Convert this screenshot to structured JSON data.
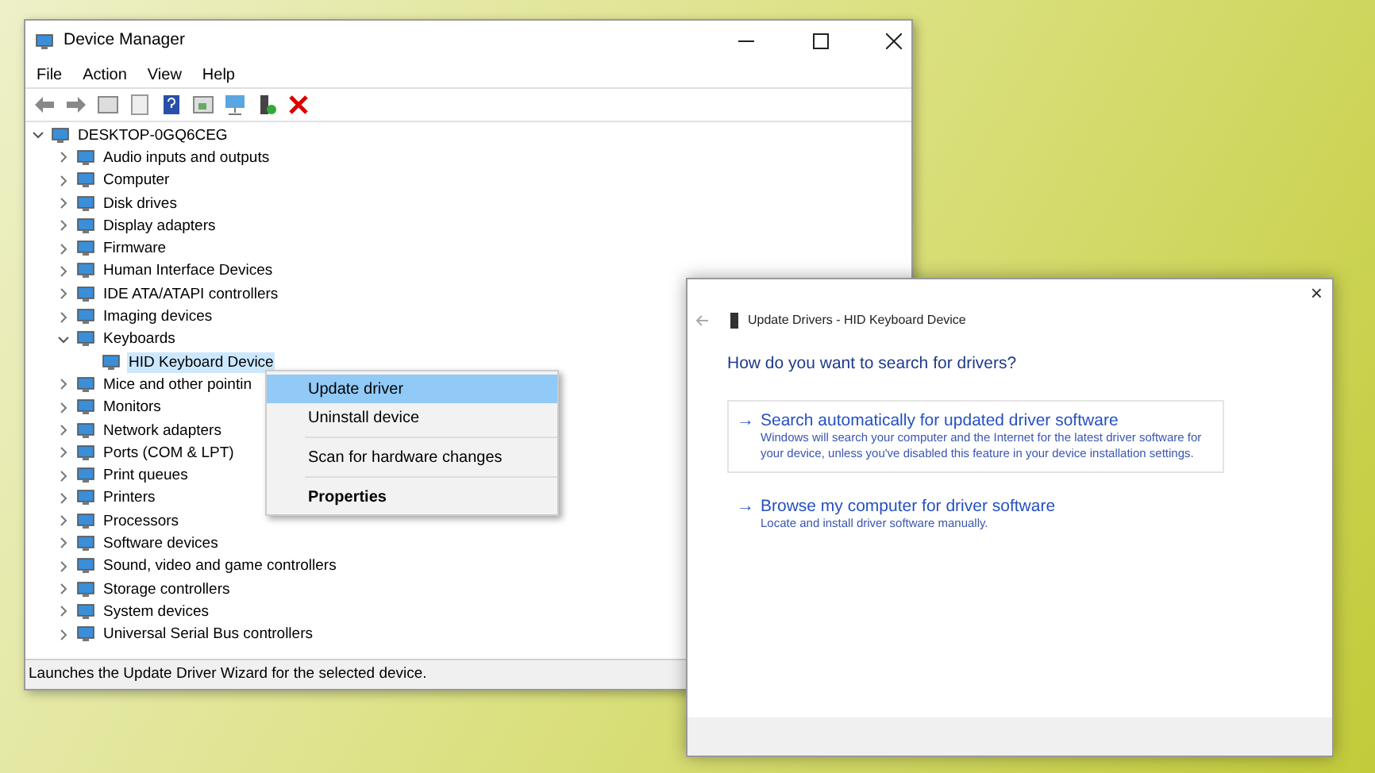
{
  "device_manager": {
    "title": "Device Manager",
    "menu": [
      "File",
      "Action",
      "View",
      "Help"
    ],
    "tree": {
      "label": "DESKTOP-0GQ6CEG",
      "expanded": true,
      "selected": false,
      "children": [
        {
          "label": "Audio inputs and outputs",
          "expanded": false,
          "selected": false
        },
        {
          "label": "Computer",
          "expanded": false,
          "selected": false
        },
        {
          "label": "Disk drives",
          "expanded": false,
          "selected": false
        },
        {
          "label": "Display adapters",
          "expanded": false,
          "selected": false
        },
        {
          "label": "Firmware",
          "expanded": false,
          "selected": false
        },
        {
          "label": "Human Interface Devices",
          "expanded": false,
          "selected": false
        },
        {
          "label": "IDE ATA/ATAPI controllers",
          "expanded": false,
          "selected": false
        },
        {
          "label": "Imaging devices",
          "expanded": false,
          "selected": false
        },
        {
          "label": "Keyboards",
          "expanded": true,
          "selected": false,
          "children": [
            {
              "label": "HID Keyboard Device",
              "selected": true
            }
          ]
        },
        {
          "label": "Mice and other pointin",
          "expanded": false,
          "selected": false
        },
        {
          "label": "Monitors",
          "expanded": false,
          "selected": false
        },
        {
          "label": "Network adapters",
          "expanded": false,
          "selected": false
        },
        {
          "label": "Ports (COM & LPT)",
          "expanded": false,
          "selected": false
        },
        {
          "label": "Print queues",
          "expanded": false,
          "selected": false
        },
        {
          "label": "Printers",
          "expanded": false,
          "selected": false
        },
        {
          "label": "Processors",
          "expanded": false,
          "selected": false
        },
        {
          "label": "Software devices",
          "expanded": false,
          "selected": false
        },
        {
          "label": "Sound, video and game controllers",
          "expanded": false,
          "selected": false
        },
        {
          "label": "Storage controllers",
          "expanded": false,
          "selected": false
        },
        {
          "label": "System devices",
          "expanded": false,
          "selected": false
        },
        {
          "label": "Universal Serial Bus controllers",
          "expanded": false,
          "selected": false
        }
      ]
    },
    "status_bar": "Launches the Update Driver Wizard for the selected device."
  },
  "context_menu": {
    "groups": [
      [
        {
          "label": "Update driver",
          "selected": true,
          "default": false
        },
        {
          "label": "Uninstall device",
          "selected": false,
          "default": false
        }
      ],
      [
        {
          "label": "Scan for hardware changes",
          "selected": false,
          "default": false
        }
      ],
      [
        {
          "label": "Properties",
          "selected": false,
          "default": true
        }
      ]
    ]
  },
  "dialog": {
    "title": "Update Drivers - HID Keyboard Device",
    "close": "×",
    "heading": "How do you want to search for drivers?",
    "options": [
      {
        "arrow": "→",
        "title": "Search automatically for updated driver software",
        "description": "Windows will search your computer and the Internet for the latest driver software for your device, unless you've disabled this feature in your device installation settings.",
        "selected": true
      },
      {
        "arrow": "→",
        "title": "Browse my computer for driver software",
        "description": "Locate and install driver software manually.",
        "selected": false
      }
    ]
  }
}
